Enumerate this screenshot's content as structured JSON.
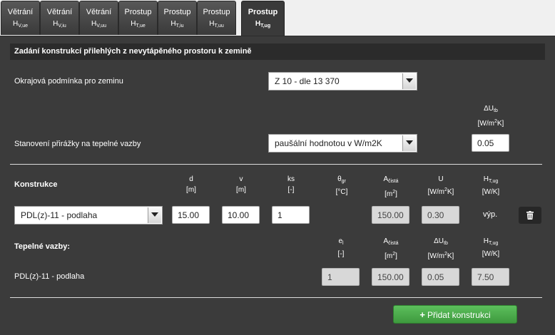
{
  "tabs": [
    {
      "label": "Větrání",
      "sub_main": "H",
      "sub_idx": "V,ue",
      "active": false
    },
    {
      "label": "Větrání",
      "sub_main": "H",
      "sub_idx": "V,iu",
      "active": false
    },
    {
      "label": "Větrání",
      "sub_main": "H",
      "sub_idx": "V,uu",
      "active": false
    },
    {
      "label": "Prostup",
      "sub_main": "H",
      "sub_idx": "T,ue",
      "active": false
    },
    {
      "label": "Prostup",
      "sub_main": "H",
      "sub_idx": "T,iu",
      "active": false
    },
    {
      "label": "Prostup",
      "sub_main": "H",
      "sub_idx": "T,uu",
      "active": false
    },
    {
      "label": "Prostup",
      "sub_main": "H",
      "sub_idx": "T,ug",
      "active": true
    }
  ],
  "section_title": "Zadání konstrukcí přilehlých z nevytápěného prostoru k zemině",
  "ground_condition": {
    "label": "Okrajová podmínka pro zeminu",
    "value": "Z 10 - dle 13 370"
  },
  "bridge_header": {
    "sym": "ΔU",
    "idx": "tb",
    "unit_pre": "[W/m",
    "unit_exp": "2",
    "unit_post": "K]"
  },
  "thermal_bridges": {
    "label": "Stanovení přirážky na tepelné vazby",
    "value": "paušální hodnotou v W/m2K",
    "delta_u": "0.05"
  },
  "construction_headers": {
    "label": "Konstrukce",
    "d": "d",
    "d_unit": "[m]",
    "v": "v",
    "v_unit": "[m]",
    "ks": "ks",
    "ks_unit": "[-]",
    "theta_sym": "θ",
    "theta_idx": "gr",
    "theta_unit": "[°C]",
    "a_sym": "A",
    "a_idx": "čistá",
    "a_unit_pre": "[m",
    "a_unit_exp": "2",
    "a_unit_post": "]",
    "u": "U",
    "u_unit_pre": "[W/m",
    "u_unit_exp": "2",
    "u_unit_post": "K]",
    "h_sym": "H",
    "h_idx": "T,ug",
    "h_unit": "[W/K]"
  },
  "construction_row": {
    "name": "PDL(z)-11 - podlaha",
    "d": "15.00",
    "v": "10.00",
    "ks": "1",
    "area": "150.00",
    "u": "0.30",
    "h": "výp."
  },
  "bridges_headers": {
    "label": "Tepelné vazby:",
    "e_sym": "e",
    "e_idx": "l",
    "e_unit": "[-]",
    "a_sym": "A",
    "a_idx": "čistá",
    "a_unit_pre": "[m",
    "a_unit_exp": "2",
    "a_unit_post": "]",
    "du_sym": "ΔU",
    "du_idx": "tb",
    "du_unit_pre": "[W/m",
    "du_unit_exp": "2",
    "du_unit_post": "K]",
    "h_sym": "H",
    "h_idx": "T,ug",
    "h_unit": "[W/K]"
  },
  "bridges_row": {
    "name": "PDL(z)-11 - podlaha",
    "e": "1",
    "area": "150.00",
    "du": "0.05",
    "h": "7.50"
  },
  "add_button": {
    "icon": "plus-icon",
    "label": "Přidat konstrukci"
  },
  "colors": {
    "panel": "#3b3b3b",
    "header_bar": "#2b2b2b",
    "button_green": "#4cae4c"
  }
}
